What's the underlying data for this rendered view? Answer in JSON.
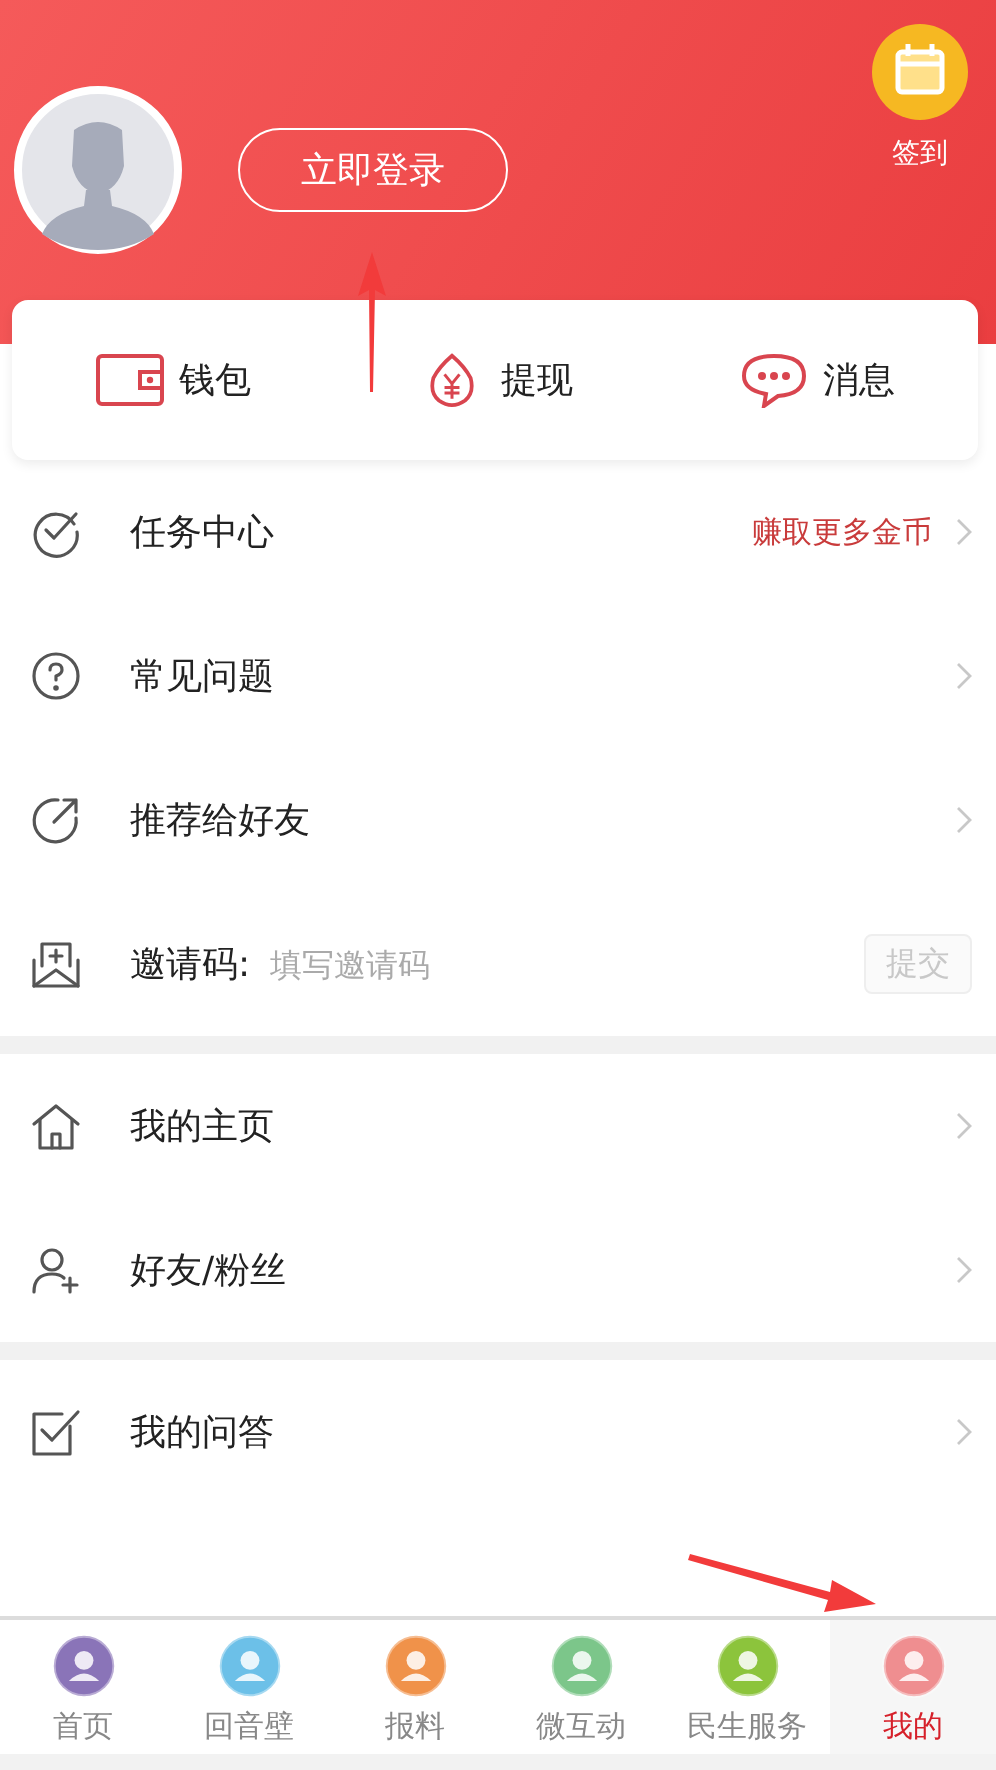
{
  "header": {
    "login_button": "立即登录",
    "checkin_label": "签到"
  },
  "quick_actions": [
    {
      "label": "钱包"
    },
    {
      "label": "提现"
    },
    {
      "label": "消息"
    }
  ],
  "sections": [
    {
      "rows": [
        {
          "kind": "link",
          "label": "任务中心",
          "hint": "赚取更多金币"
        },
        {
          "kind": "link",
          "label": "常见问题"
        },
        {
          "kind": "link",
          "label": "推荐给好友"
        },
        {
          "kind": "invite",
          "label": "邀请码:",
          "placeholder": "填写邀请码",
          "button": "提交"
        }
      ]
    },
    {
      "rows": [
        {
          "kind": "link",
          "label": "我的主页"
        },
        {
          "kind": "link",
          "label": "好友/粉丝"
        }
      ]
    },
    {
      "rows": [
        {
          "kind": "link",
          "label": "我的问答"
        }
      ]
    }
  ],
  "tab_bar": [
    {
      "label": "首页",
      "color": "#8a74b8",
      "selected": false
    },
    {
      "label": "回音壁",
      "color": "#6cc0e8",
      "selected": false
    },
    {
      "label": "报料",
      "color": "#f0924a",
      "selected": false
    },
    {
      "label": "微互动",
      "color": "#7cc68a",
      "selected": false
    },
    {
      "label": "民生服务",
      "color": "#8cc43c",
      "selected": false
    },
    {
      "label": "我的",
      "color": "#ef8e90",
      "selected": true
    }
  ]
}
